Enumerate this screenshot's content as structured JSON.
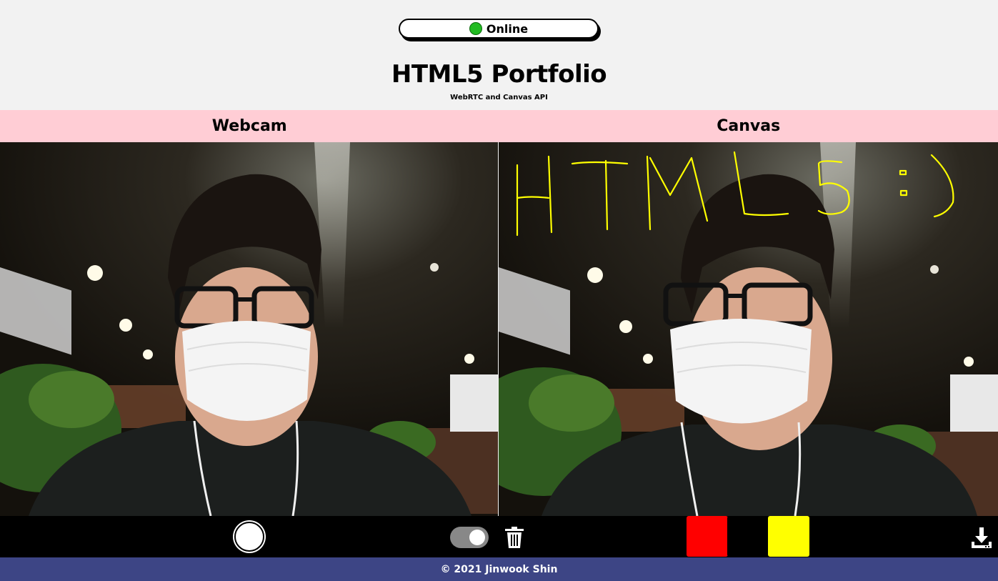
{
  "header": {
    "status": "Online",
    "status_color": "#22bb22",
    "title": "HTML5 Portfolio",
    "subtitle": "WebRTC and Canvas API"
  },
  "labels": {
    "webcam": "Webcam",
    "canvas": "Canvas"
  },
  "canvas_drawing": {
    "text": "HTML5 :)",
    "stroke_color": "#ffff00"
  },
  "toolbar": {
    "capture_icon": "circle-shutter-icon",
    "toggle_state": "on",
    "trash_icon": "trash-icon",
    "palette": [
      "#ff0000",
      "#000000",
      "#ffff00"
    ],
    "download_icon": "download-icon"
  },
  "footer": {
    "text": "© 2021 Jinwook Shin"
  }
}
